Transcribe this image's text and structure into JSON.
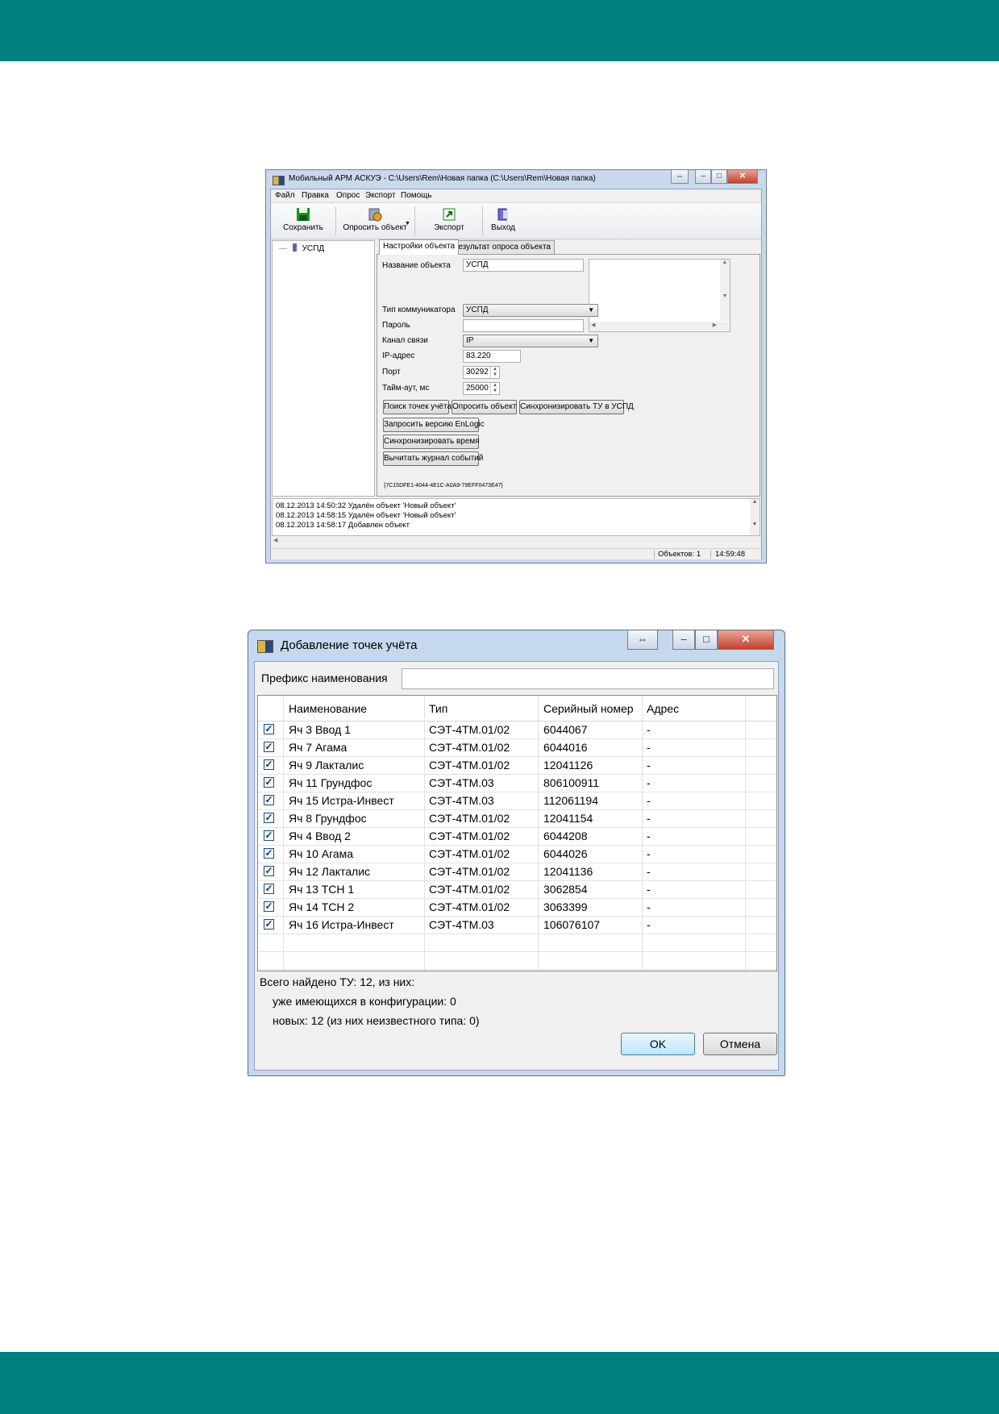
{
  "window1": {
    "title": "Мобильный АРМ АСКУЭ - C:\\Users\\Rem\\Новая папка (C:\\Users\\Rem\\Новая папка)",
    "menu": [
      "Файл",
      "Правка",
      "Опрос",
      "Экспорт",
      "Помощь"
    ],
    "toolbar": {
      "save": "Сохранить",
      "poll": "Опросить объект",
      "export": "Экспорт",
      "exit": "Выход"
    },
    "tree": {
      "root": "УСПД"
    },
    "tabs": [
      "Настройки объекта",
      "Результат опроса объекта"
    ],
    "form": {
      "name_label": "Название объекта",
      "name_value": "УСПД",
      "comm_type_label": "Тип коммуникатора",
      "comm_type_value": "УСПД",
      "password_label": "Пароль",
      "password_value": "",
      "channel_label": "Канал связи",
      "channel_value": "IP",
      "ip_label": "IP-адрес",
      "ip_value": "83.220",
      "port_label": "Порт",
      "port_value": "30292",
      "timeout_label": "Тайм-аут, мс",
      "timeout_value": "25000"
    },
    "buttons": {
      "find_points": "Поиск точек учёта",
      "poll_object": "Опросить объект",
      "sync_tu": "Синхронизировать ТУ в УСПД",
      "request_version": "Запросить версию EnLogic",
      "sync_time": "Синхронизировать время",
      "read_log": "Вычитать журнал событий"
    },
    "guid": "{7C15DFE1-4044-4E1C-A0A9-79EFF0473E47}",
    "log": [
      "08.12.2013 14:50:32  Удалён объект 'Новый объект'",
      "08.12.2013 14:58:15  Удалён объект 'Новый объект'",
      "08.12.2013 14:58:17  Добавлен объект"
    ],
    "status": {
      "objects": "Объектов: 1",
      "time": "14:59:48"
    }
  },
  "window2": {
    "title": "Добавление точек учёта",
    "prefix_label": "Префикс наименования",
    "prefix_value": "",
    "columns": [
      "Наименование",
      "Тип",
      "Серийный номер",
      "Адрес"
    ],
    "rows": [
      {
        "name": "Яч 3 Ввод 1",
        "type": "СЭТ-4ТМ.01/02",
        "serial": "6044067",
        "address": "-"
      },
      {
        "name": "Яч 7 Агама",
        "type": "СЭТ-4ТМ.01/02",
        "serial": "6044016",
        "address": "-"
      },
      {
        "name": "Яч 9 Лакталис",
        "type": "СЭТ-4ТМ.01/02",
        "serial": "12041126",
        "address": "-"
      },
      {
        "name": "Яч 11 Грундфос",
        "type": "СЭТ-4ТМ.03",
        "serial": "806100911",
        "address": "-"
      },
      {
        "name": "Яч 15 Истра-Инвест",
        "type": "СЭТ-4ТМ.03",
        "serial": "112061194",
        "address": "-"
      },
      {
        "name": "Яч 8 Грундфос",
        "type": "СЭТ-4ТМ.01/02",
        "serial": "12041154",
        "address": "-"
      },
      {
        "name": "Яч 4 Ввод 2",
        "type": "СЭТ-4ТМ.01/02",
        "serial": "6044208",
        "address": "-"
      },
      {
        "name": "Яч 10 Агама",
        "type": "СЭТ-4ТМ.01/02",
        "serial": "6044026",
        "address": "-"
      },
      {
        "name": "Яч 12 Лакталис",
        "type": "СЭТ-4ТМ.01/02",
        "serial": "12041136",
        "address": "-"
      },
      {
        "name": "Яч 13 ТСН 1",
        "type": "СЭТ-4ТМ.01/02",
        "serial": "3062854",
        "address": "-"
      },
      {
        "name": "Яч 14 ТСН 2",
        "type": "СЭТ-4ТМ.01/02",
        "serial": "3063399",
        "address": "-"
      },
      {
        "name": "Яч 16 Истра-Инвест",
        "type": "СЭТ-4ТМ.03",
        "serial": "106076107",
        "address": "-"
      }
    ],
    "summary": {
      "total": "Всего найдено ТУ: 12, из них:",
      "existing": "уже имеющихся в конфигурации: 0",
      "new": "новых: 12 (из них неизвестного типа: 0)"
    },
    "ok": "OK",
    "cancel": "Отмена"
  }
}
